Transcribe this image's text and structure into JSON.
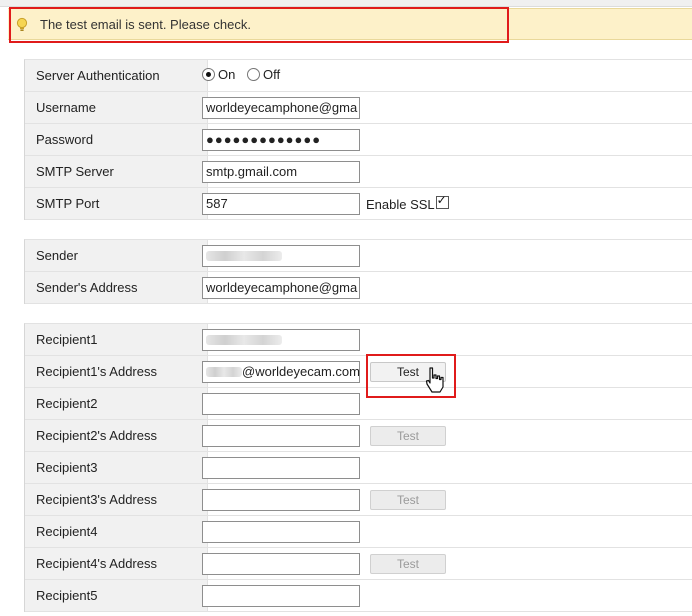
{
  "notice": {
    "message": "The test email is sent. Please check.",
    "icon": "lightbulb-icon",
    "highlight_color": "#e01b1b"
  },
  "auth": {
    "server_auth_label": "Server Authentication",
    "on_label": "On",
    "off_label": "Off",
    "selected": "On",
    "username_label": "Username",
    "username_value": "worldeyecamphone@gma",
    "password_label": "Password",
    "password_value": "●●●●●●●●●●●●●",
    "smtp_server_label": "SMTP Server",
    "smtp_server_value": "smtp.gmail.com",
    "smtp_port_label": "SMTP Port",
    "smtp_port_value": "587",
    "ssl_label": "Enable SSL",
    "ssl_checked": true
  },
  "sender": {
    "sender_label": "Sender",
    "sender_address_label": "Sender's Address",
    "sender_address_value": "worldeyecamphone@gma"
  },
  "recipients": {
    "test_label": "Test",
    "items": [
      {
        "name_label": "Recipient1",
        "address_label": "Recipient1's Address",
        "address_value": "@worldeyecam.com"
      },
      {
        "name_label": "Recipient2",
        "address_label": "Recipient2's Address",
        "address_value": ""
      },
      {
        "name_label": "Recipient3",
        "address_label": "Recipient3's Address",
        "address_value": ""
      },
      {
        "name_label": "Recipient4",
        "address_label": "Recipient4's Address",
        "address_value": ""
      },
      {
        "name_label": "Recipient5"
      }
    ]
  }
}
